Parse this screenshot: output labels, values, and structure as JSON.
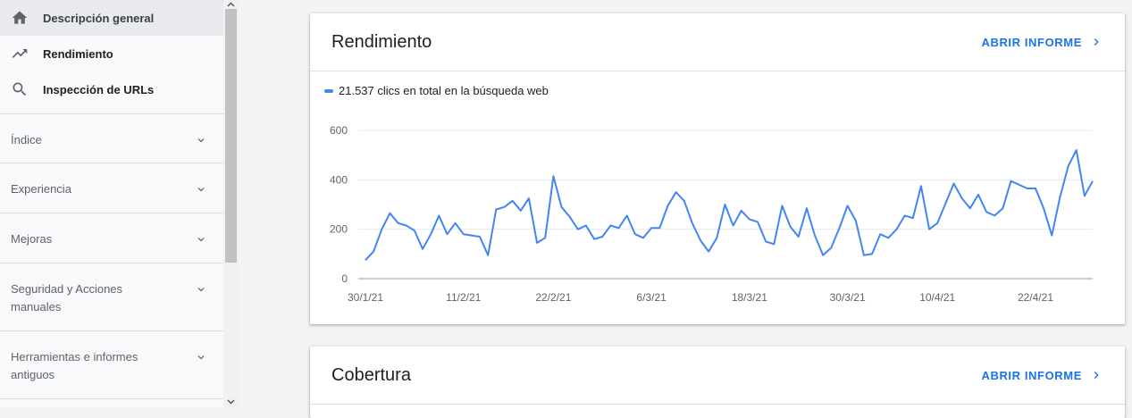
{
  "sidebar": {
    "items": [
      {
        "label": "Descripción general",
        "icon": "home-icon",
        "active": true
      },
      {
        "label": "Rendimiento",
        "icon": "trending-up-icon",
        "active": false
      },
      {
        "label": "Inspección de URLs",
        "icon": "search-icon",
        "active": false
      }
    ],
    "sections": [
      {
        "label": "Índice"
      },
      {
        "label": "Experiencia"
      },
      {
        "label": "Mejoras"
      },
      {
        "label": "Seguridad y Acciones manuales"
      },
      {
        "label": "Herramientas e informes antiguos"
      }
    ]
  },
  "performance_card": {
    "title": "Rendimiento",
    "open_report": "ABRIR INFORME",
    "legend": "21.537 clics en total en la búsqueda web"
  },
  "coverage_card": {
    "title": "Cobertura",
    "open_report": "ABRIR INFORME"
  },
  "colors": {
    "accent": "#1a73e8",
    "series": "#4285f4"
  },
  "chart_data": {
    "type": "line",
    "title": "",
    "xlabel": "",
    "ylabel": "",
    "ylim": [
      0,
      600
    ],
    "yticks": [
      "0",
      "200",
      "400",
      "600"
    ],
    "xticks": [
      "30/1/21",
      "11/2/21",
      "22/2/21",
      "6/3/21",
      "18/3/21",
      "30/3/21",
      "10/4/21",
      "22/4/21"
    ],
    "grid": true,
    "series": [
      {
        "values": [
          75,
          110,
          200,
          265,
          225,
          215,
          195,
          120,
          180,
          255,
          180,
          225,
          180,
          175,
          170,
          95,
          280,
          290,
          315,
          275,
          325,
          145,
          165,
          415,
          290,
          250,
          200,
          215,
          160,
          170,
          215,
          205,
          255,
          180,
          165,
          205,
          205,
          295,
          350,
          315,
          225,
          155,
          110,
          165,
          300,
          215,
          275,
          240,
          230,
          150,
          140,
          295,
          210,
          170,
          285,
          175,
          95,
          125,
          205,
          295,
          235,
          95,
          100,
          180,
          165,
          200,
          255,
          245,
          375,
          200,
          225,
          305,
          385,
          325,
          285,
          340,
          270,
          255,
          285,
          395,
          380,
          365,
          365,
          285,
          175,
          330,
          455,
          520,
          335,
          395
        ]
      }
    ]
  }
}
